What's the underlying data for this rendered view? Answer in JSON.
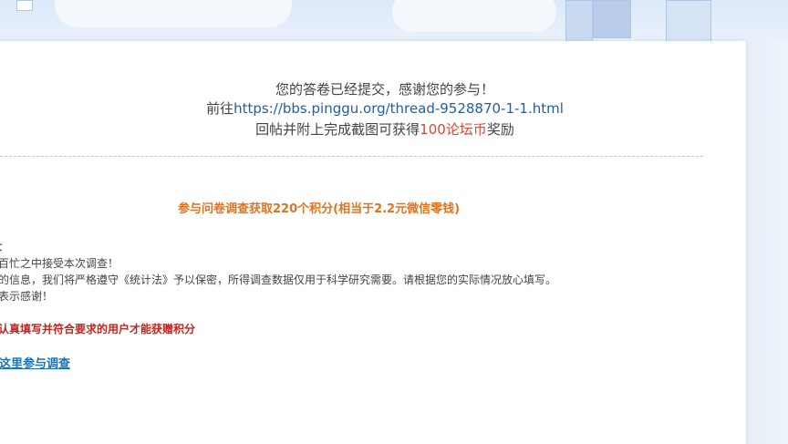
{
  "confirmation": {
    "submitted_text": "您的答卷已经提交，感谢您的参与！",
    "goto_prefix": "前往",
    "goto_link": "https://bbs.pinggu.org/thread-9528870-1-1.html",
    "reward_prefix": "回帖并附上完成截图可获得",
    "reward_amount": "100论坛币",
    "reward_suffix": "奖励"
  },
  "survey": {
    "subtitle": "参与问卷调查获取220个积分(相当于2.2元微信零钱)",
    "paragraph1": "友：",
    "paragraph2": "在百忙之中接受本次调查！",
    "paragraph3": "写的信息，我们将严格遵守《统计法》予以保密，所得调查数据仅用于科学研究需要。请根据您的实际情况放心填写。",
    "paragraph4": "您表示感谢！",
    "warning": "真认真填写并符合要求的用户才能获赠积分",
    "cta_label": "击这里参与调查"
  },
  "colors": {
    "link_blue": "#2160a8",
    "reward_red": "#e2452f",
    "subtitle_orange": "#e07321",
    "warning_red": "#c8221c",
    "cta_blue": "#1a73b8"
  }
}
